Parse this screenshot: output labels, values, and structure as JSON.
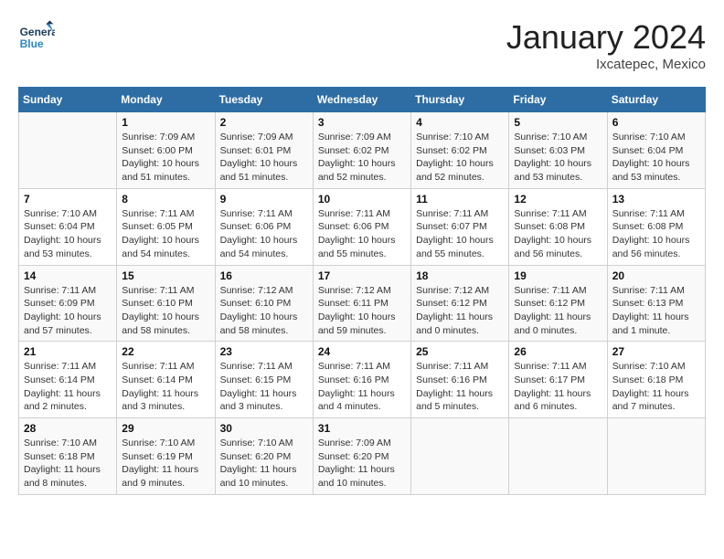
{
  "header": {
    "logo_general": "General",
    "logo_blue": "Blue",
    "month": "January 2024",
    "location": "Ixcatepec, Mexico"
  },
  "columns": [
    "Sunday",
    "Monday",
    "Tuesday",
    "Wednesday",
    "Thursday",
    "Friday",
    "Saturday"
  ],
  "weeks": [
    [
      {
        "day": "",
        "sunrise": "",
        "sunset": "",
        "daylight": ""
      },
      {
        "day": "1",
        "sunrise": "Sunrise: 7:09 AM",
        "sunset": "Sunset: 6:00 PM",
        "daylight": "Daylight: 10 hours and 51 minutes."
      },
      {
        "day": "2",
        "sunrise": "Sunrise: 7:09 AM",
        "sunset": "Sunset: 6:01 PM",
        "daylight": "Daylight: 10 hours and 51 minutes."
      },
      {
        "day": "3",
        "sunrise": "Sunrise: 7:09 AM",
        "sunset": "Sunset: 6:02 PM",
        "daylight": "Daylight: 10 hours and 52 minutes."
      },
      {
        "day": "4",
        "sunrise": "Sunrise: 7:10 AM",
        "sunset": "Sunset: 6:02 PM",
        "daylight": "Daylight: 10 hours and 52 minutes."
      },
      {
        "day": "5",
        "sunrise": "Sunrise: 7:10 AM",
        "sunset": "Sunset: 6:03 PM",
        "daylight": "Daylight: 10 hours and 53 minutes."
      },
      {
        "day": "6",
        "sunrise": "Sunrise: 7:10 AM",
        "sunset": "Sunset: 6:04 PM",
        "daylight": "Daylight: 10 hours and 53 minutes."
      }
    ],
    [
      {
        "day": "7",
        "sunrise": "Sunrise: 7:10 AM",
        "sunset": "Sunset: 6:04 PM",
        "daylight": "Daylight: 10 hours and 53 minutes."
      },
      {
        "day": "8",
        "sunrise": "Sunrise: 7:11 AM",
        "sunset": "Sunset: 6:05 PM",
        "daylight": "Daylight: 10 hours and 54 minutes."
      },
      {
        "day": "9",
        "sunrise": "Sunrise: 7:11 AM",
        "sunset": "Sunset: 6:06 PM",
        "daylight": "Daylight: 10 hours and 54 minutes."
      },
      {
        "day": "10",
        "sunrise": "Sunrise: 7:11 AM",
        "sunset": "Sunset: 6:06 PM",
        "daylight": "Daylight: 10 hours and 55 minutes."
      },
      {
        "day": "11",
        "sunrise": "Sunrise: 7:11 AM",
        "sunset": "Sunset: 6:07 PM",
        "daylight": "Daylight: 10 hours and 55 minutes."
      },
      {
        "day": "12",
        "sunrise": "Sunrise: 7:11 AM",
        "sunset": "Sunset: 6:08 PM",
        "daylight": "Daylight: 10 hours and 56 minutes."
      },
      {
        "day": "13",
        "sunrise": "Sunrise: 7:11 AM",
        "sunset": "Sunset: 6:08 PM",
        "daylight": "Daylight: 10 hours and 56 minutes."
      }
    ],
    [
      {
        "day": "14",
        "sunrise": "Sunrise: 7:11 AM",
        "sunset": "Sunset: 6:09 PM",
        "daylight": "Daylight: 10 hours and 57 minutes."
      },
      {
        "day": "15",
        "sunrise": "Sunrise: 7:11 AM",
        "sunset": "Sunset: 6:10 PM",
        "daylight": "Daylight: 10 hours and 58 minutes."
      },
      {
        "day": "16",
        "sunrise": "Sunrise: 7:12 AM",
        "sunset": "Sunset: 6:10 PM",
        "daylight": "Daylight: 10 hours and 58 minutes."
      },
      {
        "day": "17",
        "sunrise": "Sunrise: 7:12 AM",
        "sunset": "Sunset: 6:11 PM",
        "daylight": "Daylight: 10 hours and 59 minutes."
      },
      {
        "day": "18",
        "sunrise": "Sunrise: 7:12 AM",
        "sunset": "Sunset: 6:12 PM",
        "daylight": "Daylight: 11 hours and 0 minutes."
      },
      {
        "day": "19",
        "sunrise": "Sunrise: 7:11 AM",
        "sunset": "Sunset: 6:12 PM",
        "daylight": "Daylight: 11 hours and 0 minutes."
      },
      {
        "day": "20",
        "sunrise": "Sunrise: 7:11 AM",
        "sunset": "Sunset: 6:13 PM",
        "daylight": "Daylight: 11 hours and 1 minute."
      }
    ],
    [
      {
        "day": "21",
        "sunrise": "Sunrise: 7:11 AM",
        "sunset": "Sunset: 6:14 PM",
        "daylight": "Daylight: 11 hours and 2 minutes."
      },
      {
        "day": "22",
        "sunrise": "Sunrise: 7:11 AM",
        "sunset": "Sunset: 6:14 PM",
        "daylight": "Daylight: 11 hours and 3 minutes."
      },
      {
        "day": "23",
        "sunrise": "Sunrise: 7:11 AM",
        "sunset": "Sunset: 6:15 PM",
        "daylight": "Daylight: 11 hours and 3 minutes."
      },
      {
        "day": "24",
        "sunrise": "Sunrise: 7:11 AM",
        "sunset": "Sunset: 6:16 PM",
        "daylight": "Daylight: 11 hours and 4 minutes."
      },
      {
        "day": "25",
        "sunrise": "Sunrise: 7:11 AM",
        "sunset": "Sunset: 6:16 PM",
        "daylight": "Daylight: 11 hours and 5 minutes."
      },
      {
        "day": "26",
        "sunrise": "Sunrise: 7:11 AM",
        "sunset": "Sunset: 6:17 PM",
        "daylight": "Daylight: 11 hours and 6 minutes."
      },
      {
        "day": "27",
        "sunrise": "Sunrise: 7:10 AM",
        "sunset": "Sunset: 6:18 PM",
        "daylight": "Daylight: 11 hours and 7 minutes."
      }
    ],
    [
      {
        "day": "28",
        "sunrise": "Sunrise: 7:10 AM",
        "sunset": "Sunset: 6:18 PM",
        "daylight": "Daylight: 11 hours and 8 minutes."
      },
      {
        "day": "29",
        "sunrise": "Sunrise: 7:10 AM",
        "sunset": "Sunset: 6:19 PM",
        "daylight": "Daylight: 11 hours and 9 minutes."
      },
      {
        "day": "30",
        "sunrise": "Sunrise: 7:10 AM",
        "sunset": "Sunset: 6:20 PM",
        "daylight": "Daylight: 11 hours and 10 minutes."
      },
      {
        "day": "31",
        "sunrise": "Sunrise: 7:09 AM",
        "sunset": "Sunset: 6:20 PM",
        "daylight": "Daylight: 11 hours and 10 minutes."
      },
      {
        "day": "",
        "sunrise": "",
        "sunset": "",
        "daylight": ""
      },
      {
        "day": "",
        "sunrise": "",
        "sunset": "",
        "daylight": ""
      },
      {
        "day": "",
        "sunrise": "",
        "sunset": "",
        "daylight": ""
      }
    ]
  ]
}
